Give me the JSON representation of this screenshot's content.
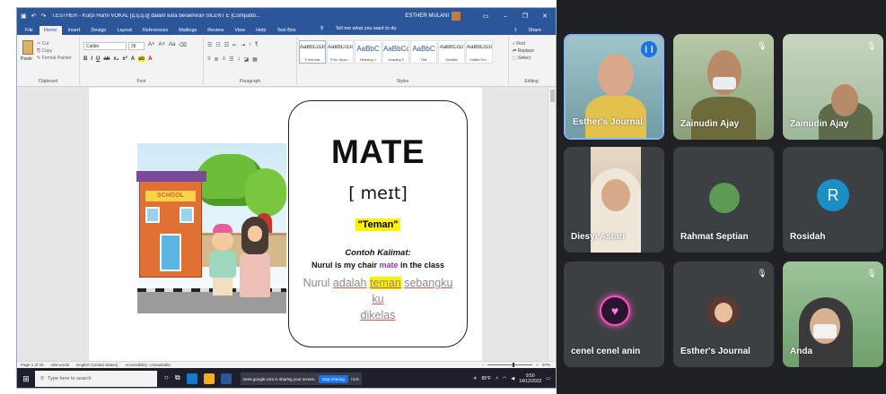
{
  "word": {
    "title": "T.ESTHER - Kurpi Hurni VOKAL [q.q.q.q] dalam kata berakhiran SILENT E [Compatib...",
    "user": "ESTHER MULANI",
    "tabs": [
      "File",
      "Home",
      "Insert",
      "Design",
      "Layout",
      "References",
      "Mailings",
      "Review",
      "View",
      "Help",
      "Text Box"
    ],
    "tell_me": "Tell me what you want to do",
    "share": "Share",
    "ribbon": {
      "clipboard_label": "Clipboard",
      "paste": "Paste",
      "cut": "Cut",
      "copy": "Copy",
      "format_painter": "Format Painter",
      "font_label": "Font",
      "font_name": "Calibri",
      "font_size": "28",
      "paragraph_label": "Paragraph",
      "styles_label": "Styles",
      "styles": [
        {
          "sample": "AaBbCcDc",
          "name": "¶ Normal"
        },
        {
          "sample": "AaBbCcDc",
          "name": "¶ No Spac..."
        },
        {
          "sample": "AaBbC",
          "name": "Heading 1"
        },
        {
          "sample": "AaBbCc",
          "name": "Heading 2"
        },
        {
          "sample": "AaBbC",
          "name": "Title"
        },
        {
          "sample": "AaBbCcD",
          "name": "Subtitle"
        },
        {
          "sample": "AaBbCcDi",
          "name": "Subtle Em..."
        }
      ],
      "editing_label": "Editing",
      "find": "Find",
      "replace": "Replace",
      "select": "Select"
    },
    "illustration": {
      "sign": "SCHOOL"
    },
    "card": {
      "word": "MATE",
      "ipa": "[ meɪt]",
      "meaning": "\"Teman\"",
      "example_label": "Contoh Kalimat:",
      "example_en_1": "Nurul is my chair ",
      "example_en_hl": "mate",
      "example_en_2": " in the class",
      "example_id_1": "Nurul ",
      "example_id_u1": "adalah",
      "example_id_2": " ",
      "example_id_hl": "teman",
      "example_id_3": " ",
      "example_id_u2": "sebangku ku",
      "example_id_4": " ",
      "example_id_u3": "dikelas"
    },
    "status": {
      "page": "Page 1 of 25",
      "words": "438 words",
      "language": "English (United States)",
      "accessibility": "Accessibility: Unavailable",
      "zoom": "97%"
    }
  },
  "taskbar": {
    "search_placeholder": "Type here to search",
    "share_message": "meet.google.com is sharing your screen.",
    "stop_sharing": "Stop sharing",
    "hide": "Hide",
    "weather": "85°F",
    "time": "9:50",
    "date": "14/12/2022"
  },
  "meet": {
    "participants": [
      {
        "name": "Esther's Journal",
        "muted": false,
        "speaking": true
      },
      {
        "name": "Zainudin Ajay",
        "muted": true
      },
      {
        "name": "Zainudin Ajay",
        "muted": true
      },
      {
        "name": "Diesyi Astari",
        "muted": false
      },
      {
        "name": "Rahmat Septian",
        "muted": false
      },
      {
        "name": "Rosidah",
        "muted": false,
        "initial": "R"
      },
      {
        "name": "cenel cenel anin",
        "muted": false
      },
      {
        "name": "Esther's Journal",
        "muted": true
      },
      {
        "name": "Anda",
        "muted": true
      }
    ]
  },
  "colors": {
    "word_blue": "#2b579a",
    "meet_bg": "#202124",
    "tile_bg": "#3c4043",
    "highlight": "#fff200",
    "active_border": "#8ab4f8",
    "rosidah_avatar": "#1a8ec5"
  }
}
